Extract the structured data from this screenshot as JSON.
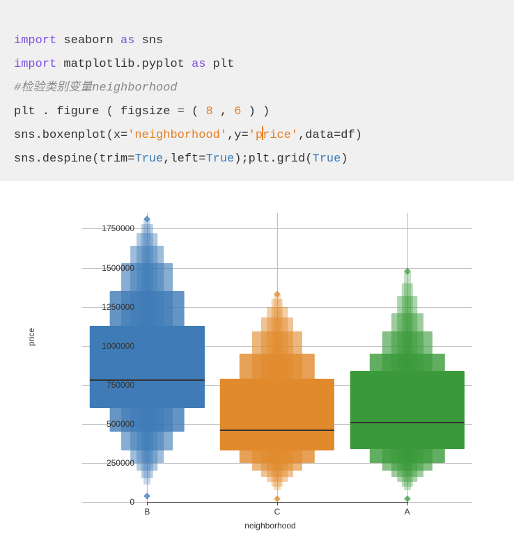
{
  "code": {
    "l1_import": "import",
    "l1_mod": " seaborn ",
    "l1_as": "as",
    "l1_alias": " sns",
    "l2_import": "import",
    "l2_mod": " matplotlib.pyplot ",
    "l2_as": "as",
    "l2_alias": " plt",
    "l3_comment": "#检验类别变量neighborhood",
    "l4_a": "plt . figure ( figsize ",
    "l4_eq": "=",
    "l4_b": " ( ",
    "l4_n1": "8",
    "l4_c": " , ",
    "l4_n2": "6",
    "l4_d": " ) )",
    "l5_a": "sns.boxenplot(x=",
    "l5_s1": "'neighborhood'",
    "l5_b": ",y=",
    "l5_s2a": "'p",
    "l5_s2b": "rice'",
    "l5_c": ",data=df)",
    "l6_a": "sns.despine(trim=",
    "l6_t1": "True",
    "l6_b": ",left=",
    "l6_t2": "True",
    "l6_c": ");plt.grid(",
    "l6_t3": "True",
    "l6_d": ")"
  },
  "chart_data": {
    "type": "boxen",
    "xlabel": "neighborhood",
    "ylabel": "price",
    "title": "",
    "ylim": [
      0,
      1850000
    ],
    "yticks": [
      0,
      250000,
      500000,
      750000,
      1000000,
      1250000,
      1500000,
      1750000
    ],
    "categories": [
      "B",
      "C",
      "A"
    ],
    "series": [
      {
        "name": "B",
        "color": "#3e7bb7",
        "median": 780000,
        "levels": [
          {
            "low": 600000,
            "high": 1130000,
            "width": 1.0,
            "alpha": 1.0
          },
          {
            "low": 450000,
            "high": 1350000,
            "width": 0.65,
            "alpha": 0.8
          },
          {
            "low": 330000,
            "high": 1530000,
            "width": 0.45,
            "alpha": 0.62
          },
          {
            "low": 250000,
            "high": 1640000,
            "width": 0.29,
            "alpha": 0.5
          },
          {
            "low": 200000,
            "high": 1720000,
            "width": 0.18,
            "alpha": 0.42
          },
          {
            "low": 150000,
            "high": 1780000,
            "width": 0.1,
            "alpha": 0.36
          },
          {
            "low": 110000,
            "high": 1810000,
            "width": 0.06,
            "alpha": 0.3
          }
        ],
        "outliers_low": [
          40000
        ],
        "outliers_high": [
          1810000
        ]
      },
      {
        "name": "C",
        "color": "#e08a2c",
        "median": 460000,
        "levels": [
          {
            "low": 330000,
            "high": 790000,
            "width": 1.0,
            "alpha": 1.0
          },
          {
            "low": 250000,
            "high": 950000,
            "width": 0.66,
            "alpha": 0.8
          },
          {
            "low": 200000,
            "high": 1090000,
            "width": 0.44,
            "alpha": 0.62
          },
          {
            "low": 160000,
            "high": 1180000,
            "width": 0.28,
            "alpha": 0.5
          },
          {
            "low": 130000,
            "high": 1250000,
            "width": 0.18,
            "alpha": 0.42
          },
          {
            "low": 100000,
            "high": 1300000,
            "width": 0.1,
            "alpha": 0.36
          },
          {
            "low": 75000,
            "high": 1330000,
            "width": 0.06,
            "alpha": 0.3
          }
        ],
        "outliers_low": [
          20000
        ],
        "outliers_high": [
          1330000
        ]
      },
      {
        "name": "A",
        "color": "#3a9a3a",
        "median": 510000,
        "levels": [
          {
            "low": 340000,
            "high": 840000,
            "width": 1.0,
            "alpha": 1.0
          },
          {
            "low": 250000,
            "high": 950000,
            "width": 0.66,
            "alpha": 0.8
          },
          {
            "low": 200000,
            "high": 1090000,
            "width": 0.44,
            "alpha": 0.62
          },
          {
            "low": 160000,
            "high": 1210000,
            "width": 0.28,
            "alpha": 0.5
          },
          {
            "low": 130000,
            "high": 1320000,
            "width": 0.18,
            "alpha": 0.42
          },
          {
            "low": 100000,
            "high": 1400000,
            "width": 0.1,
            "alpha": 0.36
          },
          {
            "low": 75000,
            "high": 1470000,
            "width": 0.06,
            "alpha": 0.3
          }
        ],
        "outliers_low": [
          20000
        ],
        "outliers_high": [
          1480000
        ]
      }
    ]
  }
}
